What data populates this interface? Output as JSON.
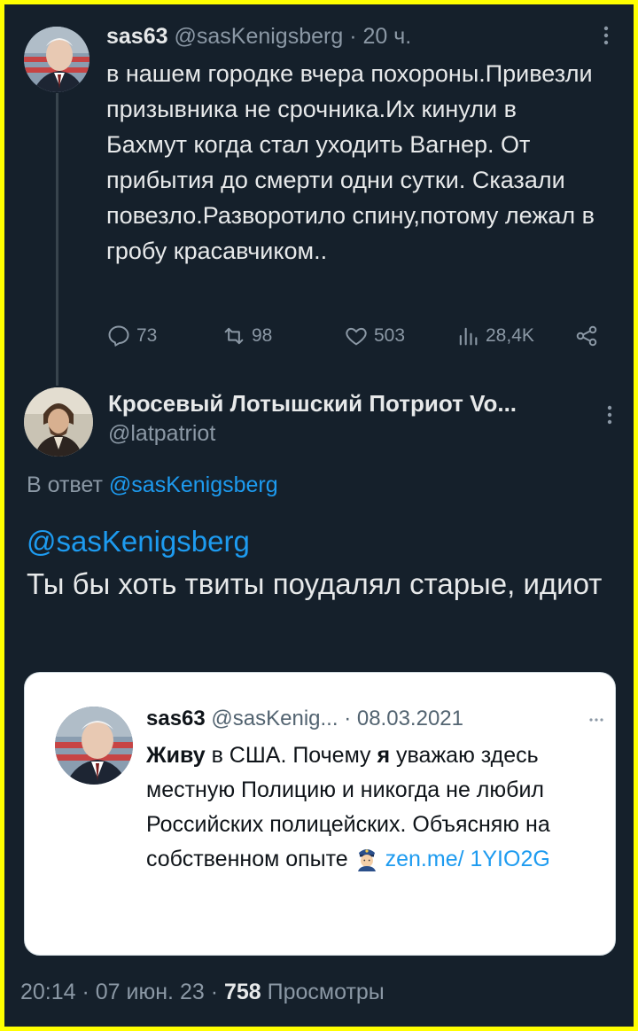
{
  "tweet": {
    "author_name": "sas63",
    "author_handle": "@sasKenigsberg",
    "time": "· 20 ч.",
    "text": "в нашем городке вчера похороны.Привезли призывника не срочника.Их кинули в Бахмут когда стал уходить Вагнер. От прибытия до смерти одни сутки. Сказали повезло.Разворотило спину,потому лежал в гробу красавчиком..",
    "stats": {
      "replies": "73",
      "retweets": "98",
      "likes": "503",
      "views": "28,4K"
    }
  },
  "reply": {
    "author_name": "Кросевый Лотышский Потриот Vo...",
    "author_handle": "@latpatriot",
    "reply_to_label": "В ответ",
    "reply_to_handle": "@sasKenigsberg",
    "mention": "@sasKenigsberg",
    "text": "Ты бы хоть твиты поудалял старые, идиот"
  },
  "quote": {
    "author_name": "sas63",
    "author_handle": "@sasKenig...",
    "date": "· 08.03.2021",
    "bold1": "Живу",
    "text1": " в США. Почему ",
    "bold2": "я",
    "text2": " уважаю здесь местную Полицию и никогда не любил Российских полицейских. Объясняю на собственном опыте ",
    "link": "zen.me/ 1YIO2G"
  },
  "footer": {
    "datetime": "20:14 · 07 июн. 23 · ",
    "views_count": "758",
    "views_label": " Просмотры"
  },
  "colors": {
    "frame_border": "#ffff00",
    "background": "#15202b",
    "link": "#1d9bf0",
    "muted": "#8b98a5"
  },
  "icons": [
    "reply-icon",
    "retweet-icon",
    "like-icon",
    "views-icon",
    "share-icon",
    "more-icon",
    "police-officer-emoji"
  ]
}
